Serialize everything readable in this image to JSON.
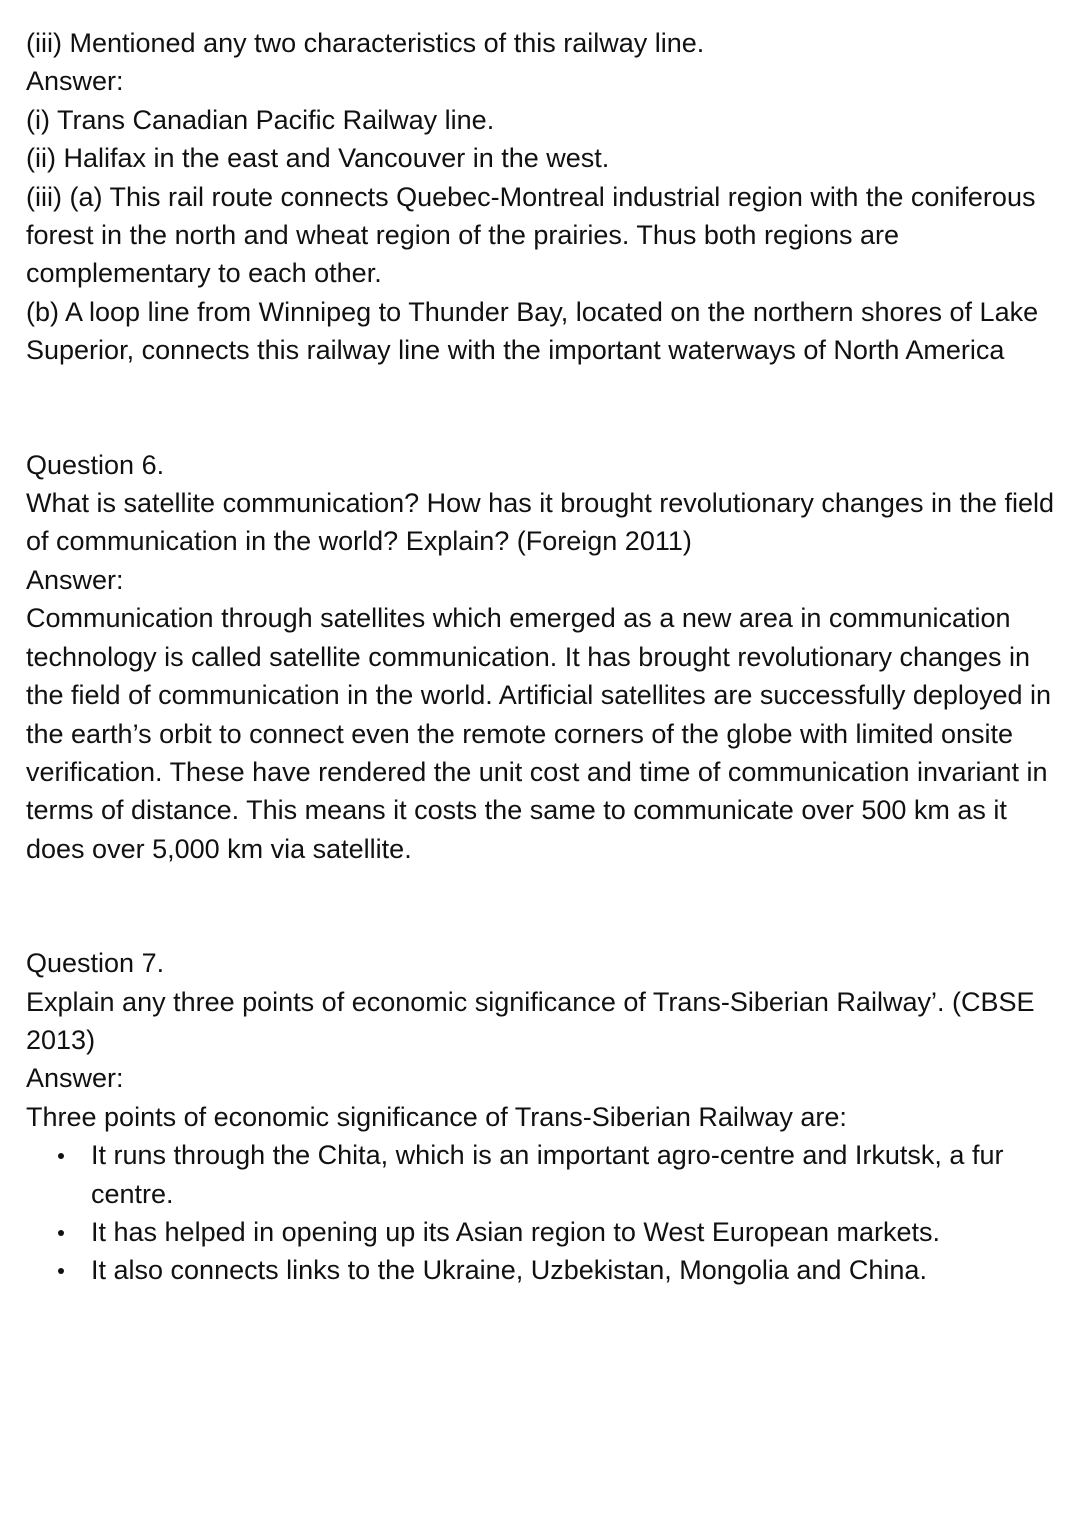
{
  "prev_question": {
    "tail": "(iii) Mentioned any two characteristics of this railway line.",
    "answer_label": "Answer:",
    "answers": [
      "(i) Trans Canadian Pacific Railway line.",
      "(ii) Halifax in the east and Vancouver in the west.",
      "(iii) (a) This rail route connects Quebec-Montreal industrial region with the coniferous forest in the north and wheat region of the prairies. Thus both regions are complementary to each other.",
      "(b) A loop line from Winnipeg to Thunder Bay, located on the northern shores of Lake Superior, connects this railway line with the important waterways of North America"
    ]
  },
  "q6": {
    "heading": "Question 6.",
    "question": "What is satellite communication? How has it brought revolutionary changes in the field of communication in the world? Explain? (Foreign 2011)",
    "answer_label": "Answer:",
    "answer": "Communication through satellites which emerged as a new area in communication technology is called satellite communication. It has brought revolutionary changes in the field of communication in the world. Artificial satellites are successfully deployed in the earth’s orbit to connect even the remote corners of the globe with limited onsite verification. These have rendered the unit cost and time of communication invariant in terms of distance. This means it costs the same to communicate over 500 km as it does over 5,000 km via satellite."
  },
  "q7": {
    "heading": "Question 7.",
    "question": "Explain any three points of economic significance of Trans-Siberian Railway’. (CBSE 2013)",
    "answer_label": "Answer:",
    "intro": "Three points of economic significance of Trans-Siberian Railway are:",
    "points": [
      "It runs through the Chita, which is an important agro-centre and Irkutsk, a fur centre.",
      "It has helped in opening up its Asian region to West European markets.",
      "It also connects links to the Ukraine, Uzbekistan, Mongolia and China."
    ]
  }
}
